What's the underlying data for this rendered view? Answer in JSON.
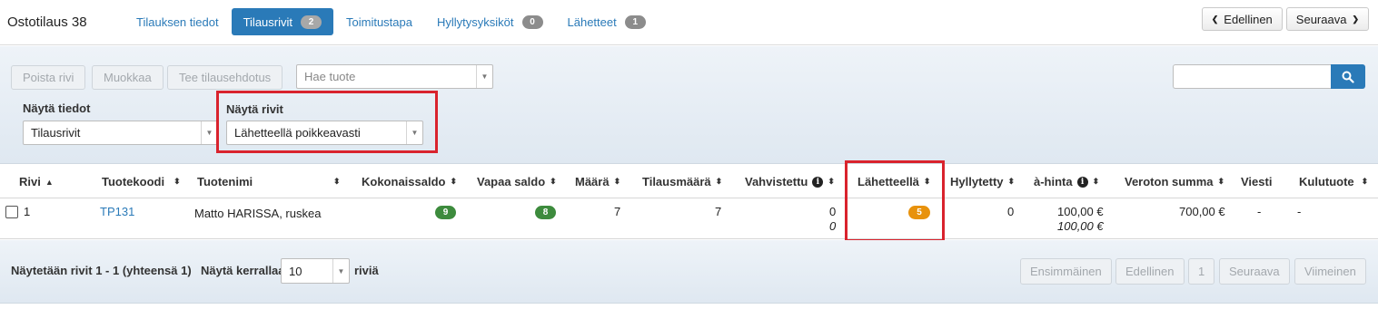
{
  "header": {
    "title": "Ostotilaus 38",
    "tabs": [
      {
        "label": "Tilauksen tiedot",
        "badge": null,
        "active": false
      },
      {
        "label": "Tilausrivit",
        "badge": "2",
        "active": true
      },
      {
        "label": "Toimitustapa",
        "badge": null,
        "active": false
      },
      {
        "label": "Hyllytysyksiköt",
        "badge": "0",
        "active": false
      },
      {
        "label": "Lähetteet",
        "badge": "1",
        "active": false
      }
    ],
    "prev_label": "Edellinen",
    "next_label": "Seuraava"
  },
  "toolbar": {
    "delete_label": "Poista rivi",
    "edit_label": "Muokkaa",
    "suggest_label": "Tee tilausehdotus",
    "product_search_placeholder": "Hae tuote",
    "show_data_label": "Näytä tiedot",
    "show_data_value": "Tilausrivit",
    "show_rows_label": "Näytä rivit",
    "show_rows_value": "Lähetteellä poikkeavasti",
    "search_value": ""
  },
  "table": {
    "columns": [
      "Rivi",
      "Tuotekoodi",
      "Tuotenimi",
      "Kokonaissaldo",
      "Vapaa saldo",
      "Määrä",
      "Tilausmäärä",
      "Vahvistettu",
      "Lähetteellä",
      "Hyllytetty",
      "à-hinta",
      "Veroton summa",
      "Viesti",
      "Kulutuote"
    ],
    "rows": [
      {
        "rivi": "1",
        "tuotekoodi": "TP131",
        "tuotenimi": "Matto HARISSA, ruskea",
        "kokonaissaldo": "9",
        "vapaa_saldo": "8",
        "maara": "7",
        "tilausmaara": "7",
        "vahvistettu": "0",
        "vahvistettu_sub": "0",
        "lahetteella": "5",
        "hyllytetty": "0",
        "a_hinta": "100,00 €",
        "a_hinta_sub": "100,00 €",
        "veroton_summa": "700,00 €",
        "viesti": "-",
        "kulutuote": "-"
      }
    ]
  },
  "footer": {
    "showing_text": "Näytetään rivit 1 - 1 (yhteensä 1)",
    "per_page_label": "Näytä kerrallaan",
    "per_page_value": "10",
    "rows_suffix": "riviä",
    "first_label": "Ensimmäinen",
    "prev_label": "Edellinen",
    "page": "1",
    "next_label": "Seuraava",
    "last_label": "Viimeinen"
  },
  "colors": {
    "accent": "#2a7ab8",
    "badge_green": "#3d8b3d",
    "badge_orange": "#e8920c",
    "highlight_red": "#d9232d"
  },
  "icons": [
    "chevron-left-icon",
    "chevron-right-icon",
    "search-icon",
    "info-icon",
    "sort-icon",
    "caret-down-icon"
  ]
}
